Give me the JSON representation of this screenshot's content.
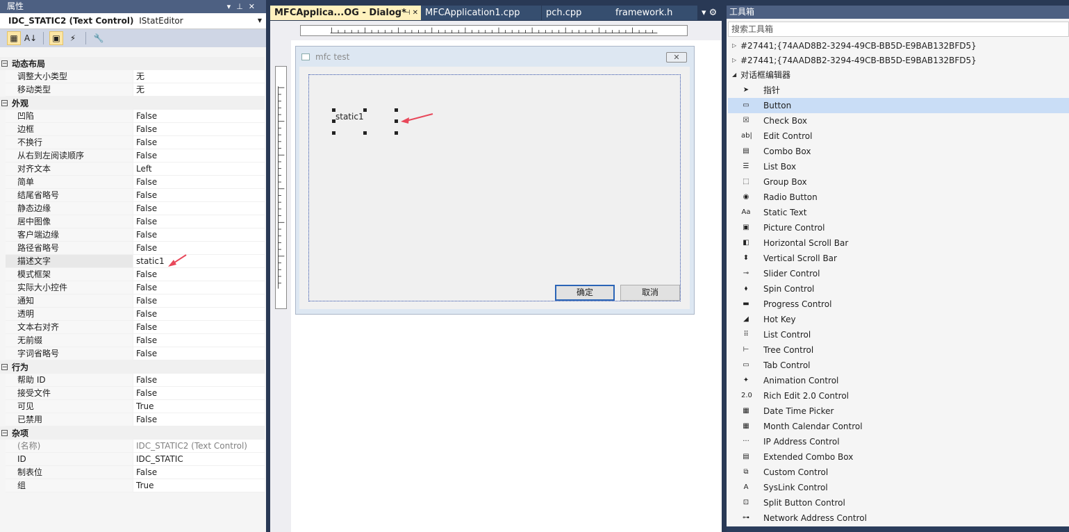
{
  "properties": {
    "title": "属性",
    "object_name": "IDC_STATIC2 (Text Control)",
    "object_editor": "IStatEditor",
    "categories": [
      {
        "name": "动态布局",
        "rows": [
          {
            "k": "调整大小类型",
            "v": "无"
          },
          {
            "k": "移动类型",
            "v": "无"
          }
        ]
      },
      {
        "name": "外观",
        "rows": [
          {
            "k": "凹陷",
            "v": "False"
          },
          {
            "k": "边框",
            "v": "False"
          },
          {
            "k": "不换行",
            "v": "False"
          },
          {
            "k": "从右到左阅读顺序",
            "v": "False"
          },
          {
            "k": "对齐文本",
            "v": "Left"
          },
          {
            "k": "简单",
            "v": "False"
          },
          {
            "k": "结尾省略号",
            "v": "False"
          },
          {
            "k": "静态边缘",
            "v": "False"
          },
          {
            "k": "居中图像",
            "v": "False"
          },
          {
            "k": "客户端边缘",
            "v": "False"
          },
          {
            "k": "路径省略号",
            "v": "False"
          },
          {
            "k": "描述文字",
            "v": "static1",
            "selected": true
          },
          {
            "k": "模式框架",
            "v": "False"
          },
          {
            "k": "实际大小控件",
            "v": "False"
          },
          {
            "k": "通知",
            "v": "False"
          },
          {
            "k": "透明",
            "v": "False"
          },
          {
            "k": "文本右对齐",
            "v": "False"
          },
          {
            "k": "无前缀",
            "v": "False"
          },
          {
            "k": "字词省略号",
            "v": "False"
          }
        ]
      },
      {
        "name": "行为",
        "rows": [
          {
            "k": "帮助 ID",
            "v": "False"
          },
          {
            "k": "接受文件",
            "v": "False"
          },
          {
            "k": "可见",
            "v": "True"
          },
          {
            "k": "已禁用",
            "v": "False"
          }
        ]
      },
      {
        "name": "杂项",
        "rows": [
          {
            "k": "(名称)",
            "v": "IDC_STATIC2 (Text Control)",
            "dim": true
          },
          {
            "k": "ID",
            "v": "IDC_STATIC"
          },
          {
            "k": "制表位",
            "v": "False"
          },
          {
            "k": "组",
            "v": "True"
          }
        ]
      }
    ]
  },
  "tabs": [
    {
      "label": "MFCApplica...OG - Dialog*",
      "active": true
    },
    {
      "label": "MFCApplication1.cpp"
    },
    {
      "label": "pch.cpp"
    },
    {
      "label": "framework.h"
    }
  ],
  "dialog": {
    "caption": "mfc test",
    "close_glyph": "✕",
    "static_text": "static1",
    "ok_label": "确定",
    "cancel_label": "取消"
  },
  "toolbox": {
    "title": "工具箱",
    "search_placeholder": "搜索工具箱",
    "groups": [
      {
        "label": "#27441;{74AAD8B2-3294-49CB-BB5D-E9BAB132BFD5}"
      },
      {
        "label": "#27441;{74AAD8B2-3294-49CB-BB5D-E9BAB132BFD5}"
      }
    ],
    "section": "对话框编辑器",
    "items": [
      {
        "label": "指针",
        "icon": "pointer-icon",
        "glyph": "➤"
      },
      {
        "label": "Button",
        "icon": "button-icon",
        "glyph": "▭",
        "selected": true
      },
      {
        "label": "Check Box",
        "icon": "checkbox-icon",
        "glyph": "☒"
      },
      {
        "label": "Edit Control",
        "icon": "edit-control-icon",
        "glyph": "ab|"
      },
      {
        "label": "Combo Box",
        "icon": "combo-box-icon",
        "glyph": "▤"
      },
      {
        "label": "List Box",
        "icon": "list-box-icon",
        "glyph": "☰"
      },
      {
        "label": "Group Box",
        "icon": "group-box-icon",
        "glyph": "⬚"
      },
      {
        "label": "Radio Button",
        "icon": "radio-button-icon",
        "glyph": "◉"
      },
      {
        "label": "Static Text",
        "icon": "static-text-icon",
        "glyph": "Aa"
      },
      {
        "label": "Picture Control",
        "icon": "picture-control-icon",
        "glyph": "▣"
      },
      {
        "label": "Horizontal Scroll Bar",
        "icon": "hscroll-icon",
        "glyph": "◧"
      },
      {
        "label": "Vertical Scroll Bar",
        "icon": "vscroll-icon",
        "glyph": "⬍"
      },
      {
        "label": "Slider Control",
        "icon": "slider-icon",
        "glyph": "⊸"
      },
      {
        "label": "Spin Control",
        "icon": "spin-icon",
        "glyph": "⬧"
      },
      {
        "label": "Progress Control",
        "icon": "progress-icon",
        "glyph": "▬"
      },
      {
        "label": "Hot Key",
        "icon": "hotkey-icon",
        "glyph": "◢"
      },
      {
        "label": "List Control",
        "icon": "list-control-icon",
        "glyph": "⠿"
      },
      {
        "label": "Tree Control",
        "icon": "tree-control-icon",
        "glyph": "⊢"
      },
      {
        "label": "Tab Control",
        "icon": "tab-control-icon",
        "glyph": "▭"
      },
      {
        "label": "Animation Control",
        "icon": "animation-icon",
        "glyph": "✦"
      },
      {
        "label": "Rich Edit 2.0 Control",
        "icon": "rich-edit-icon",
        "glyph": "2.0"
      },
      {
        "label": "Date Time Picker",
        "icon": "date-time-picker-icon",
        "glyph": "▦"
      },
      {
        "label": "Month Calendar Control",
        "icon": "month-calendar-icon",
        "glyph": "▦"
      },
      {
        "label": "IP Address Control",
        "icon": "ip-address-icon",
        "glyph": "···"
      },
      {
        "label": "Extended Combo Box",
        "icon": "extended-combo-icon",
        "glyph": "▤"
      },
      {
        "label": "Custom Control",
        "icon": "custom-control-icon",
        "glyph": "⧉"
      },
      {
        "label": "SysLink Control",
        "icon": "syslink-icon",
        "glyph": "A"
      },
      {
        "label": "Split Button Control",
        "icon": "split-button-icon",
        "glyph": "⊡"
      },
      {
        "label": "Network Address Control",
        "icon": "network-address-icon",
        "glyph": "⊶"
      }
    ]
  }
}
